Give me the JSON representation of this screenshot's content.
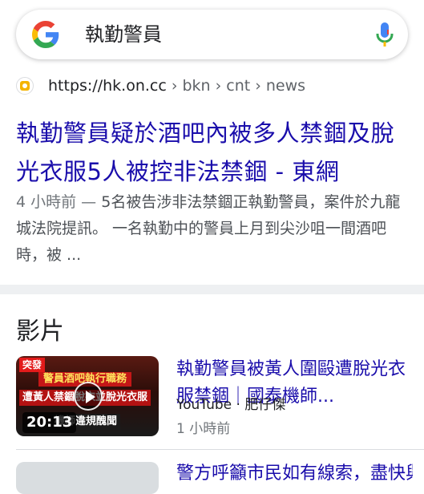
{
  "search": {
    "query": "執勤警員",
    "logo": "google-g-logo",
    "mic_icon": "microphone-icon"
  },
  "result": {
    "favicon": "on-cc-favicon",
    "url_host": "https://hk.on.cc",
    "url_path": " › bkn › cnt › news",
    "title": "執勤警員疑於酒吧內被多人禁錮及脫光衣服5人被控非法禁錮 - 東網",
    "snippet_time": "4 小時前",
    "snippet_sep": " — ",
    "snippet_text": "5名被告涉非法禁錮正執勤警員，案件於九龍城法院提訊。 一名執勤中的警員上月到尖沙咀一間酒吧時，被 ..."
  },
  "videos": {
    "heading": "影片",
    "items": [
      {
        "thumb_badge": "突發",
        "thumb_line1": "警員酒吧執行職務",
        "thumb_line2": "遭黃人禁錮脫衣並脫光衣服",
        "thumb_line3": "機師違規醜聞",
        "duration": "20:13",
        "title": "執勤警員被黃人圍毆遭脫光衣服禁錮｜國泰機師...",
        "source": "YouTube · 肥仔傑",
        "time": "1 小時前"
      }
    ],
    "next_title": "警方呼籲市民如有線索，盡快與警方聯絡"
  },
  "colors": {
    "link": "#1a0dab",
    "text": "#202124",
    "muted": "#70757a",
    "divider": "#eef0f2"
  }
}
